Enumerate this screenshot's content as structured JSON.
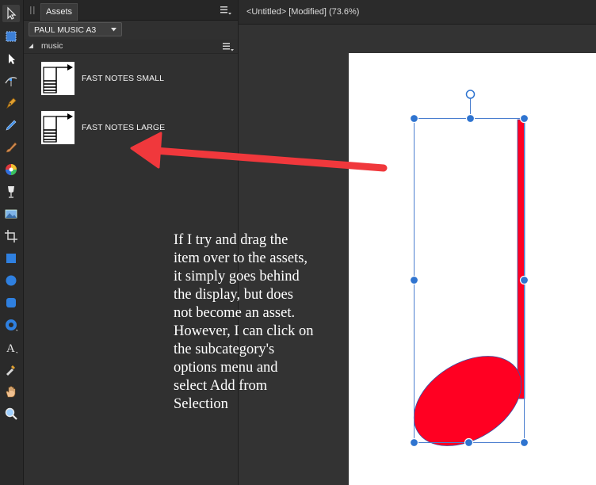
{
  "panel": {
    "tab_label": "Assets",
    "category_value": "PAUL MUSIC A3",
    "subcategory_label": "music",
    "assets": [
      {
        "label": "FAST NOTES SMALL"
      },
      {
        "label": "FAST NOTES LARGE"
      }
    ]
  },
  "document": {
    "title": "<Untitled> [Modified] (73.6%)"
  },
  "annotation": {
    "lines": [
      "If I try and drag the",
      "item over to the assets,",
      "it simply goes behind",
      "the display, but does",
      "not become an asset.",
      "However, I can click on",
      "the subcategory's",
      "options menu and",
      "select Add from",
      "Selection"
    ]
  },
  "colors": {
    "note_fill": "#ff0022",
    "arrow": "#f0383c",
    "selection": "#2f74d0"
  },
  "icons": [
    "move-tool-icon",
    "artboard-tool-icon",
    "node-tool-icon",
    "corner-tool-icon",
    "pen-tool-icon",
    "pencil-tool-icon",
    "brush-tool-icon",
    "color-picker-icon",
    "fill-tool-icon",
    "place-image-icon",
    "crop-tool-icon",
    "rectangle-tool-icon",
    "ellipse-tool-icon",
    "rounded-rectangle-tool-icon",
    "donut-tool-icon",
    "text-tool-icon",
    "eyedropper-tool-icon",
    "hand-tool-icon",
    "zoom-tool-icon"
  ]
}
